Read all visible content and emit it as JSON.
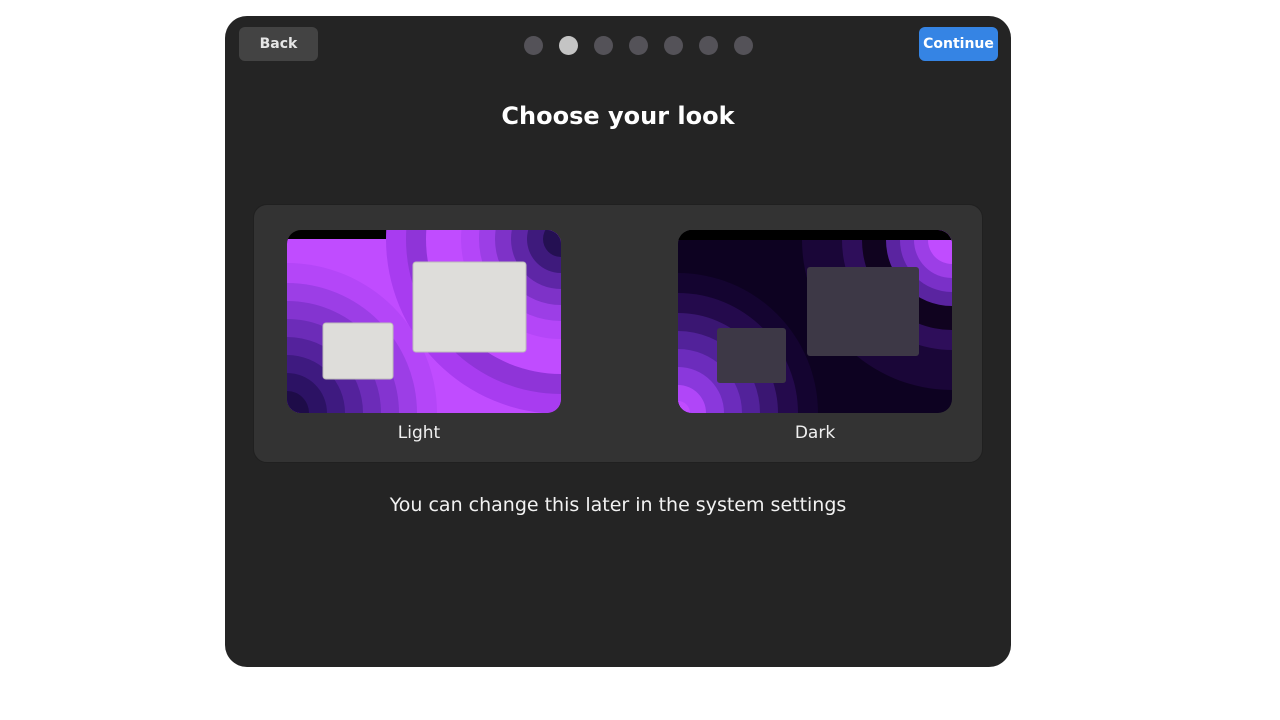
{
  "header": {
    "back_label": "Back",
    "continue_label": "Continue",
    "steps_total": 7,
    "steps_active_index": 1
  },
  "page": {
    "title": "Choose your look",
    "note": "You can change this later in the system settings"
  },
  "choices": [
    {
      "label": "Light"
    },
    {
      "label": "Dark"
    }
  ],
  "colors": {
    "accent": "#3584e4",
    "window_bg": "#242424",
    "panel_bg": "#333333",
    "wallpaper_purple": "#c04cff",
    "light_window": "#deddda",
    "dark_window": "#3d3846"
  }
}
